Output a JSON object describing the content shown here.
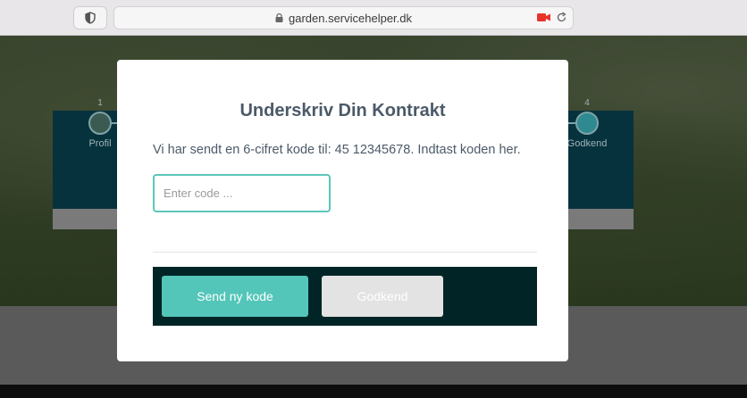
{
  "browser": {
    "url": "garden.servicehelper.dk"
  },
  "stepper": {
    "steps": [
      {
        "number": "1",
        "label": "Profil"
      },
      {
        "number": "4",
        "label": "Godkend"
      }
    ]
  },
  "modal": {
    "title": "Underskriv Din Kontrakt",
    "message": "Vi har sendt en 6-cifret kode til: 45 12345678. Indtast koden her.",
    "code_input": {
      "placeholder": "Enter code ...",
      "value": ""
    },
    "buttons": {
      "resend_label": "Send ny kode",
      "approve_label": "Godkend"
    }
  },
  "colors": {
    "accent": "#53c6b9",
    "action_bar": "#012526",
    "stepper_bg": "#06323d",
    "title_text": "#4c5a68"
  }
}
